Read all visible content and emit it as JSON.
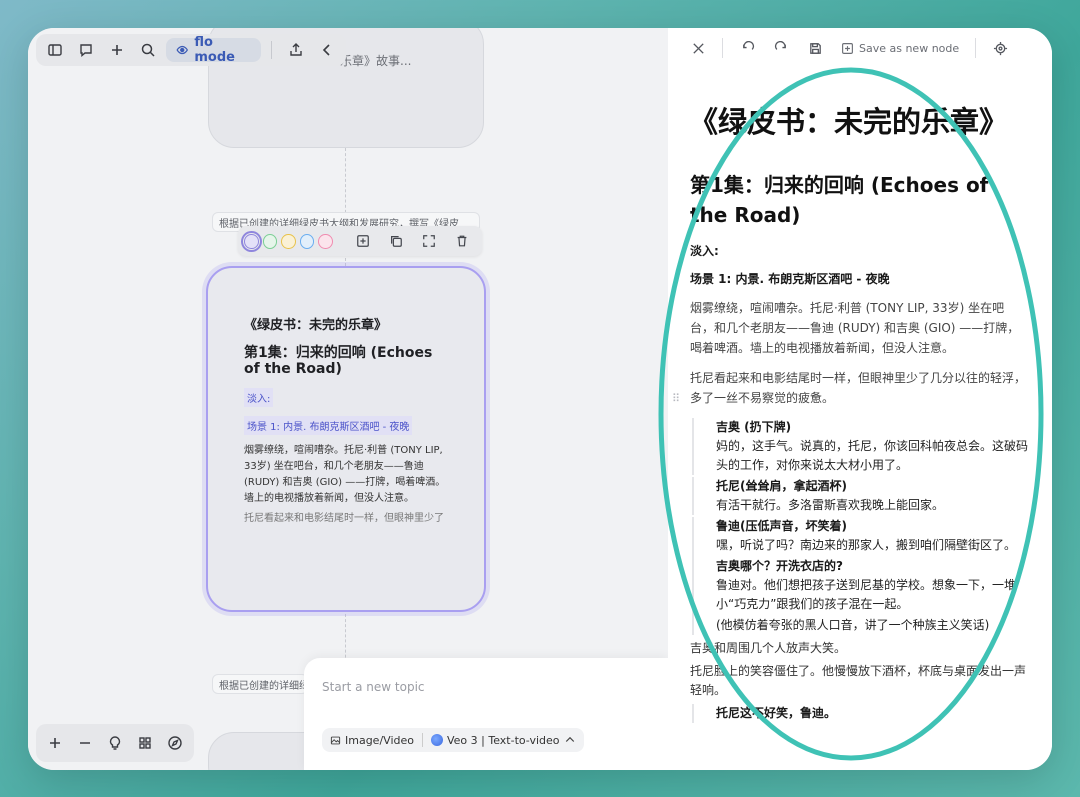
{
  "toolbar_top": {
    "mode_label": "flo mode",
    "icons": [
      "sidebar-icon",
      "comment-icon",
      "plus-icon",
      "search-icon",
      "eye-icon",
      "share-icon",
      "chevron-left-icon"
    ]
  },
  "canvas": {
    "ghost_node_text": "乐章》故事...",
    "edge_label_top": "根据已创建的详细绿皮书大纲和发展研究，撰写《绿皮",
    "edge_label_bottom": "根据已创建的详细绿",
    "swatches": [
      "#8f86dd",
      "#7ccf95",
      "#e8c24a",
      "#6aaef0",
      "#f08bb0"
    ],
    "main_node": {
      "title": "《绿皮书：未完的乐章》",
      "heading": "第1集：归来的回响 (Echoes of the Road)",
      "tag1": "淡入:",
      "tag2": "场景 1: 内景. 布朗克斯区酒吧 - 夜晚",
      "p1": "烟雾缭绕，喧闹嘈杂。托尼·利普 (TONY LIP, 33岁) 坐在吧台，和几个老朋友——鲁迪 (RUDY) 和吉奥 (GIO) ——打牌，喝着啤酒。墙上的电视播放着新闻，但没人注意。",
      "p2": "托尼看起来和电影结尾时一样，但眼神里少了"
    }
  },
  "composer": {
    "placeholder": "Start a new topic",
    "chip_media": "Image/Video",
    "chip_model": "Veo 3 | Text-to-video"
  },
  "panel": {
    "save_label": "Save as new node",
    "h1": "《绿皮书：未完的乐章》",
    "h2": "第1集：归来的回响 (Echoes of the Road)",
    "fade_in": "淡入:",
    "scene": "场景 1: 内景. 布朗克斯区酒吧 - 夜晚",
    "para1": "烟雾缭绕，喧闹嘈杂。托尼·利普 (TONY LIP, 33岁) 坐在吧台，和几个老朋友——鲁迪 (RUDY) 和吉奥 (GIO) ——打牌，喝着啤酒。墙上的电视播放着新闻，但没人注意。",
    "para2": "托尼看起来和电影结尾时一样，但眼神里少了几分以往的轻浮，多了一丝不易察觉的疲惫。",
    "dialogues": [
      {
        "speaker": "吉奥 (扔下牌)",
        "line": "妈的，这手气。说真的，托尼，你该回科帕夜总会。这破码头的工作，对你来说太大材小用了。"
      },
      {
        "speaker": "托尼(耸耸肩，拿起酒杯)",
        "line": "有活干就行。多洛雷斯喜欢我晚上能回家。"
      },
      {
        "speaker": "鲁迪(压低声音，坏笑着)",
        "line": "嘿，听说了吗？南边来的那家人，搬到咱们隔壁街区了。"
      },
      {
        "speaker": "吉奥哪个？开洗衣店的?",
        "line": "鲁迪对。他们想把孩子送到尼基的学校。想象一下，一堆小“巧克力”跟我们的孩子混在一起。"
      },
      {
        "speaker": "",
        "line": "(他模仿着夸张的黑人口音，讲了一个种族主义笑话)"
      }
    ],
    "para3": "吉奥和周围几个人放声大笑。",
    "para4": "托尼脸上的笑容僵住了。他慢慢放下酒杯，杯底与桌面发出一声轻响。",
    "dialogue_last": "托尼这不好笑，鲁迪。"
  }
}
